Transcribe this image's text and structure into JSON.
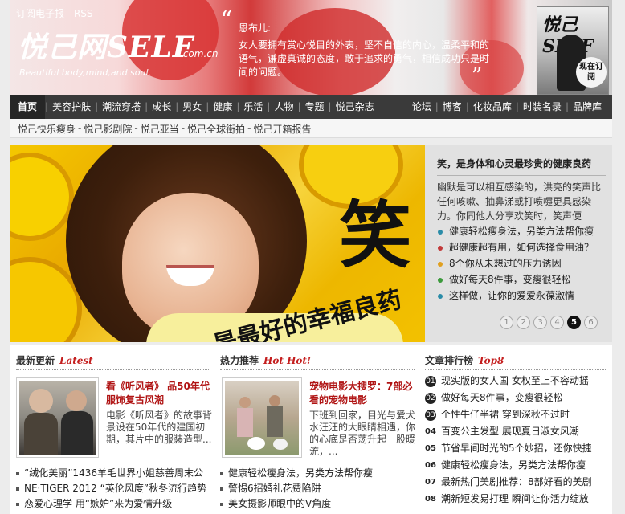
{
  "header": {
    "rss_link": "订阅电子报 - RSS",
    "logo": "悦己网SELF",
    "logo_domain": ".com.cn",
    "tagline": "Beautiful body,mind,and soul.",
    "quote_author": "恩布儿:",
    "quote_text": "女人要拥有赏心悦目的外表，坚不自信的内心，温柔平和的语气，谦虚真诚的态度，敢于追求的勇气，相信成功只是时间的问题。",
    "magazine_title": "悦己SELF",
    "magazine_badge": "现在订阅"
  },
  "nav": {
    "items": [
      "首页",
      "美容护肤",
      "潮流穿搭",
      "成长",
      "男女",
      "健康",
      "乐活",
      "人物",
      "专题",
      "悦己杂志"
    ],
    "right_items": [
      "论坛",
      "博客",
      "化妆品库",
      "时装名录",
      "品牌库"
    ]
  },
  "subnav": {
    "items": [
      "悦己快乐瘦身",
      "悦己影剧院",
      "悦己亚当",
      "悦己全球街拍",
      "悦己开箱报告"
    ]
  },
  "hero": {
    "big_char": "笑",
    "caption": "是最好的幸福良药",
    "side_title": "笑，是身体和心灵最珍贵的健康良药",
    "side_summary": "幽默是可以相互感染的，洪亮的笑声比任何咳嗽、抽鼻涕或打喷嚏更具感染力。你同他人分享欢笑时，笑声便",
    "links": [
      {
        "text": "健康轻松瘦身法，另类方法帮你瘦",
        "color": "#2a8ca8"
      },
      {
        "text": "超健康超有用，如何选择食用油？",
        "color": "#c23a3a"
      },
      {
        "text": "8个你从未想过的压力诱因",
        "color": "#e0a020"
      },
      {
        "text": "做好每天8件事，变瘦很轻松",
        "color": "#3c9a3c"
      },
      {
        "text": "这样做，让你的爱爱永葆激情",
        "color": "#2a8ca8"
      }
    ],
    "pager": [
      "1",
      "2",
      "3",
      "4",
      "5",
      "6"
    ],
    "pager_active": "5"
  },
  "latest": {
    "heading": "最新更新",
    "heading_en": "Latest",
    "title": "看《听风者》 品50年代服饰复古风潮",
    "text": "电影《听风者》的故事背景设在50年代的建国初期，其片中的服装造型...",
    "list": [
      "“绒化美丽”1436羊毛世界小姐慈善周末公",
      "NE·TIGER 2012 “英伦风度”秋冬流行趋势",
      "恋爱心理学 用“嫉妒”来为爱情升级"
    ]
  },
  "hot": {
    "heading": "热力推荐",
    "heading_en": "Hot Hot!",
    "title": "宠物电影大搜罗：7部必看的宠物电影",
    "text": "下班到回家，目光与爱犬水汪汪的大眼睛相遇，你的心底是否荡升起一股暖流，...",
    "list": [
      "健康轻松瘦身法，另类方法帮你瘦",
      "警惕6招婚礼花费陷阱",
      "美女摄影师眼中的V角度"
    ]
  },
  "rank": {
    "heading": "文章排行榜",
    "heading_en": "Top8",
    "items": [
      {
        "no": "01",
        "text": "现实版的女人国 女权至上不容动摇"
      },
      {
        "no": "02",
        "text": "做好每天8件事，变瘦很轻松"
      },
      {
        "no": "03",
        "text": "个性牛仔半裙 穿到深秋不过时"
      },
      {
        "no": "04",
        "text": "百变公主发型 展现夏日淑女风潮"
      },
      {
        "no": "05",
        "text": "节省早间时光的5个妙招，还你快捷"
      },
      {
        "no": "06",
        "text": "健康轻松瘦身法，另类方法帮你瘦"
      },
      {
        "no": "07",
        "text": "最新热门美剧推荐：8部好看的美剧"
      },
      {
        "no": "08",
        "text": "潮新短发易打理 瞬间让你活力绽放"
      }
    ]
  }
}
